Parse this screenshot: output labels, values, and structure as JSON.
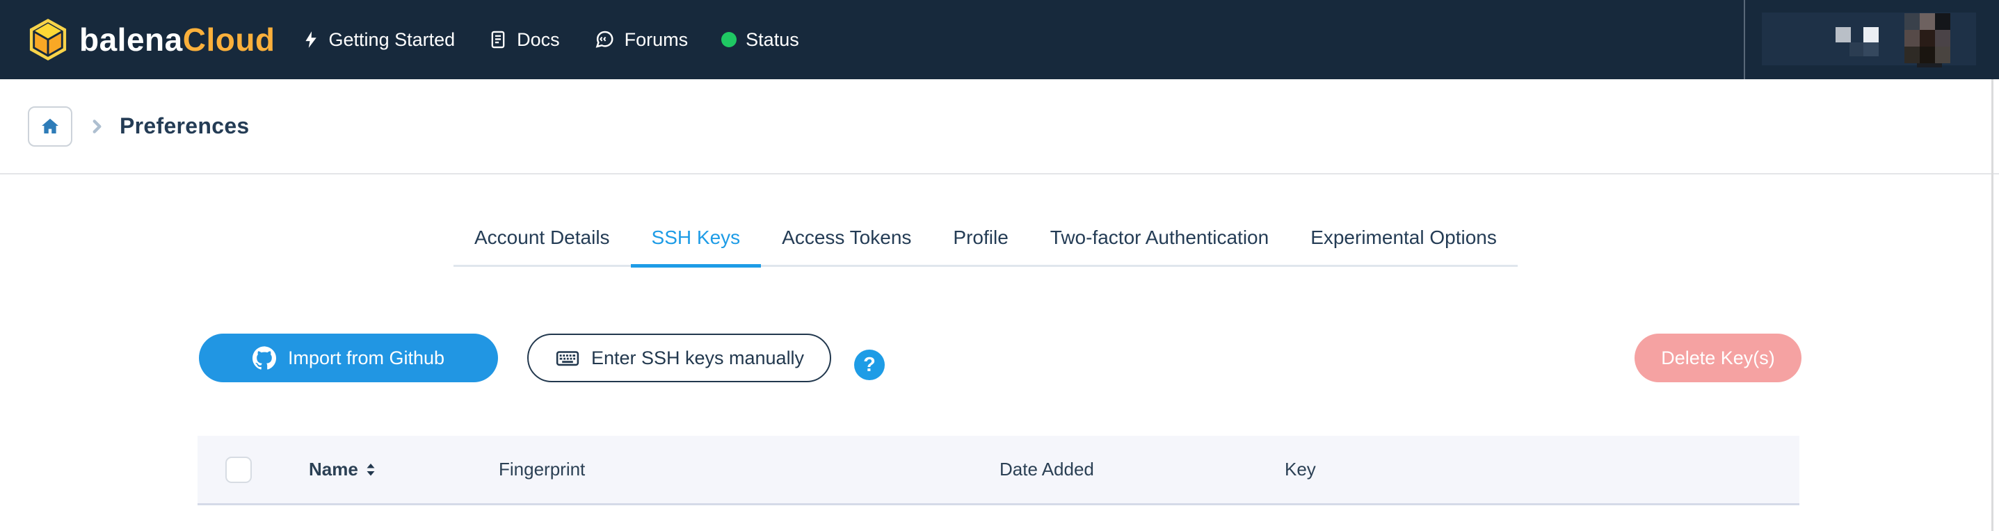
{
  "brand": {
    "name": "balena",
    "suffix": "Cloud"
  },
  "navbar": {
    "links": [
      {
        "label": "Getting Started"
      },
      {
        "label": "Docs"
      },
      {
        "label": "Forums"
      },
      {
        "label": "Status"
      }
    ]
  },
  "breadcrumb": {
    "current": "Preferences"
  },
  "tabs": {
    "active": "SSH Keys",
    "items": [
      {
        "label": "Account Details"
      },
      {
        "label": "SSH Keys"
      },
      {
        "label": "Access Tokens"
      },
      {
        "label": "Profile"
      },
      {
        "label": "Two-factor Authentication"
      },
      {
        "label": "Experimental Options"
      }
    ]
  },
  "toolbar": {
    "import_github_label": "Import from Github",
    "enter_ssh_label": "Enter SSH keys manually",
    "help_glyph": "?",
    "delete_label": "Delete Key(s)"
  },
  "table": {
    "columns": [
      "Name",
      "Fingerprint",
      "Date Added",
      "Key"
    ]
  },
  "colors": {
    "navbar_bg": "#17293c",
    "accent_blue": "#1e9ce6",
    "button_blue": "#2196e3",
    "brand_yellow": "#fbb03b",
    "status_green": "#1fc863",
    "danger_pink": "#f5a2a2",
    "text_navy": "#243c55",
    "table_header_bg": "#f5f6fb"
  }
}
